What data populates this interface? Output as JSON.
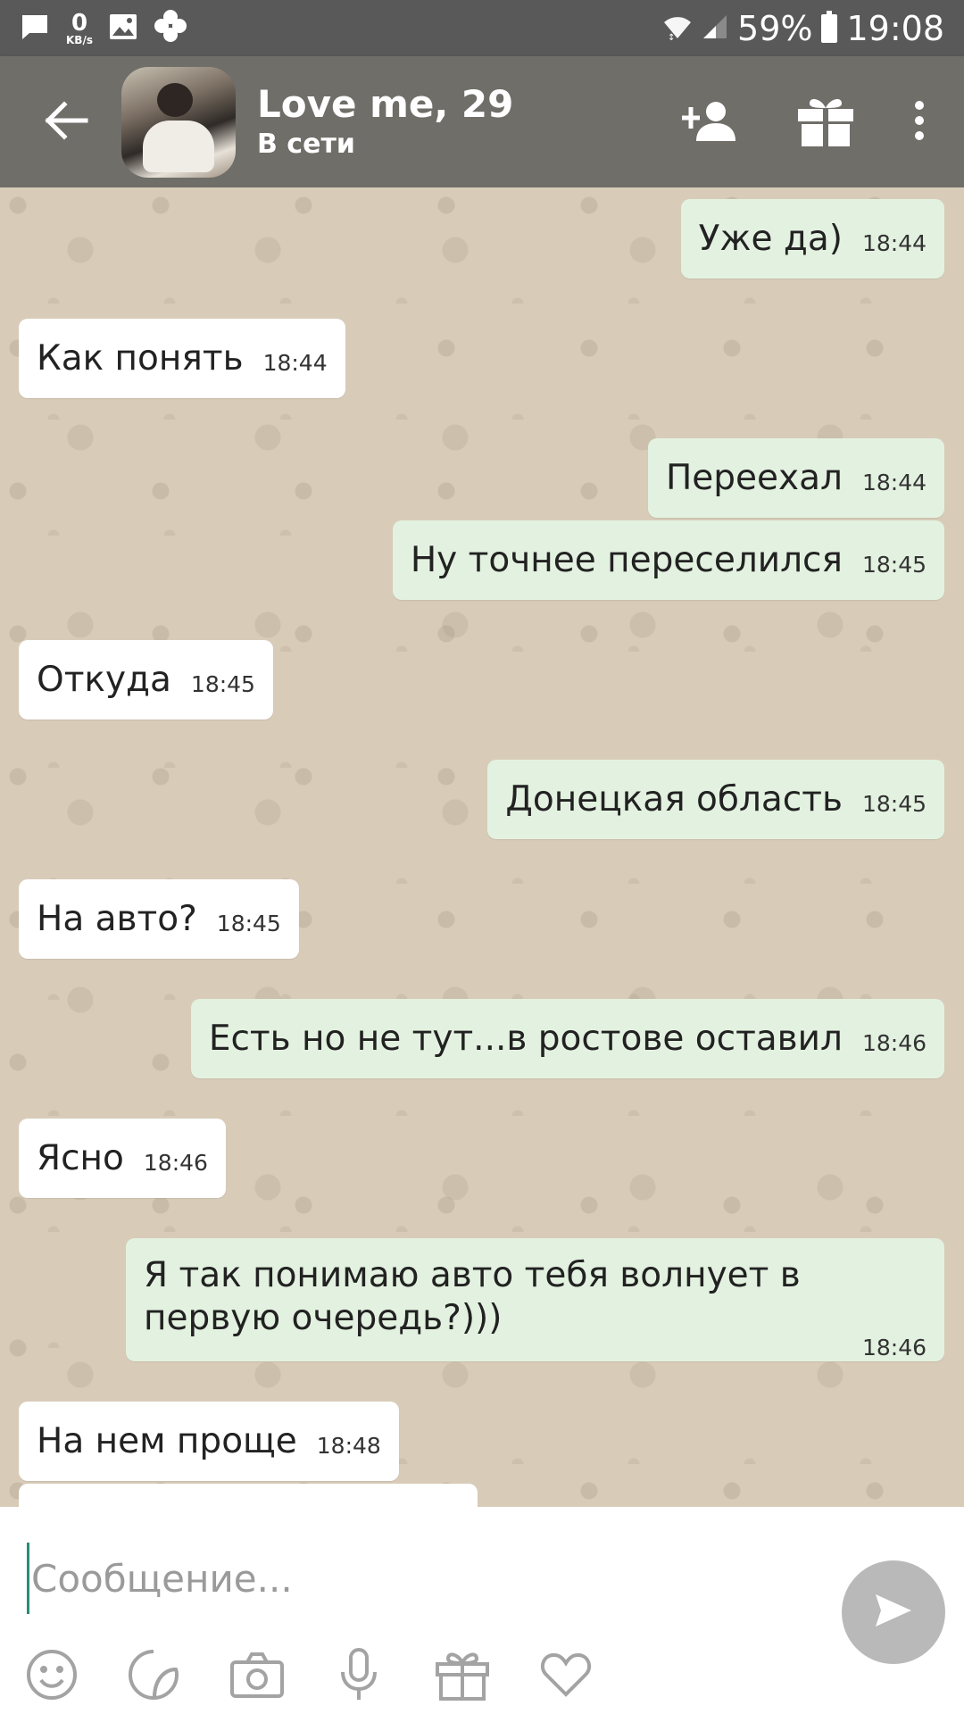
{
  "status_bar": {
    "speed_value": "0",
    "speed_unit": "KB/s",
    "battery": "59%",
    "time": "19:08"
  },
  "header": {
    "name": "Love me, 29",
    "status": "В сети"
  },
  "messages": [
    {
      "direction": "out",
      "text": "Уже да)",
      "time": "18:44"
    },
    {
      "direction": "in",
      "text": "Как понять",
      "time": "18:44"
    },
    {
      "direction": "out",
      "text": "Переехал",
      "time": "18:44"
    },
    {
      "direction": "out",
      "text": "Ну точнее переселился",
      "time": "18:45"
    },
    {
      "direction": "in",
      "text": "Откуда",
      "time": "18:45"
    },
    {
      "direction": "out",
      "text": "Донецкая область",
      "time": "18:45"
    },
    {
      "direction": "in",
      "text": "На авто?",
      "time": "18:45"
    },
    {
      "direction": "out",
      "text": "Есть но не тут...в ростове оставил",
      "time": "18:46"
    },
    {
      "direction": "in",
      "text": "Ясно",
      "time": "18:46"
    },
    {
      "direction": "out",
      "text": "Я так понимаю авто тебя волнует в первую очередь?)))",
      "time": "18:46"
    },
    {
      "direction": "in",
      "text": "На нем проще",
      "time": "18:48"
    }
  ],
  "composer": {
    "placeholder": "Сообщение..."
  },
  "colors": {
    "header_bg": "#6f6e69",
    "status_bar_bg": "#595959",
    "chat_bg": "#d8ccb9",
    "incoming_bubble": "#ffffff",
    "outgoing_bubble": "#e3f2e0",
    "send_button": "#b9b9b9"
  },
  "icons": {
    "status_bar": [
      "message-icon",
      "image-icon",
      "clover-icon",
      "wifi-icon",
      "signal-icon",
      "battery-icon"
    ],
    "header": [
      "back-arrow-icon",
      "add-friend-icon",
      "gift-icon",
      "more-vert-icon"
    ],
    "composer": [
      "send-icon",
      "smile-icon",
      "sticker-icon",
      "camera-icon",
      "mic-icon",
      "gift-icon",
      "heart-icon"
    ]
  }
}
